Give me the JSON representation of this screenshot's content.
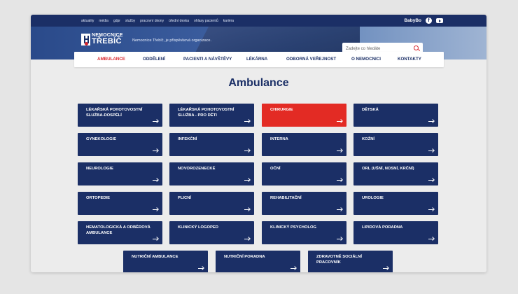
{
  "topbar": {
    "links": [
      "aktuality",
      "média",
      "gdpr",
      "služby",
      "pracovní úkony",
      "úřední deska",
      "ohlasy pacientů",
      "kariéra"
    ],
    "babybox": "BabyBo",
    "facebook_icon": "facebook-icon",
    "youtube_icon": "youtube-icon"
  },
  "header": {
    "logo_line1": "NEMOCNICE",
    "logo_line2": "TŘEBÍČ",
    "tagline": "Nemocnice Třebíč, je příspěvková organizace.",
    "search_placeholder": "Zadejte co hledáte"
  },
  "nav": {
    "items": [
      "AMBULANCE",
      "ODDĚLENÍ",
      "PACIENTI A NÁVŠTĚVY",
      "LÉKÁRNA",
      "ODBORNÁ VEŘEJNOST",
      "O NEMOCNICI",
      "KONTAKTY"
    ],
    "active": "AMBULANCE"
  },
  "page": {
    "title": "Ambulance"
  },
  "tiles": [
    "LÉKAŘSKÁ POHOTOVOSTNÍ SLUŽBA-DOSPĚLÍ",
    "LÉKAŘSKÁ POHOTOVOSTNÍ SLUŽBA - PRO DĚTI",
    "CHIRURGIE",
    "DĚTSKÁ",
    "GYNEKOLOGIE",
    "INFEKČNÍ",
    "INTERNA",
    "KOŽNÍ",
    "NEUROLOGIE",
    "NOVOROZENECKÉ",
    "OČNÍ",
    "ORL (UŠNÍ, NOSNÍ, KRČNÍ)",
    "ORTOPEDIE",
    "PLICNÍ",
    "REHABILITAČNÍ",
    "UROLOGIE",
    "HEMATOLOGICKÁ A ODBĚROVÁ AMBULANCE",
    "KLINICKÝ LOGOPED",
    "KLINICKÝ PSYCHOLOG",
    "LIPIDOVÁ PORADNA",
    "NUTRIČNÍ AMBULANCE",
    "NUTRIČNÍ PORADNA",
    "ZDRAVOTNĚ SOCIÁLNÍ PRACOVNÍK"
  ],
  "highlight_tile": "CHIRURGIE",
  "colors": {
    "navy": "#1b2f66",
    "red": "#e32b24"
  }
}
